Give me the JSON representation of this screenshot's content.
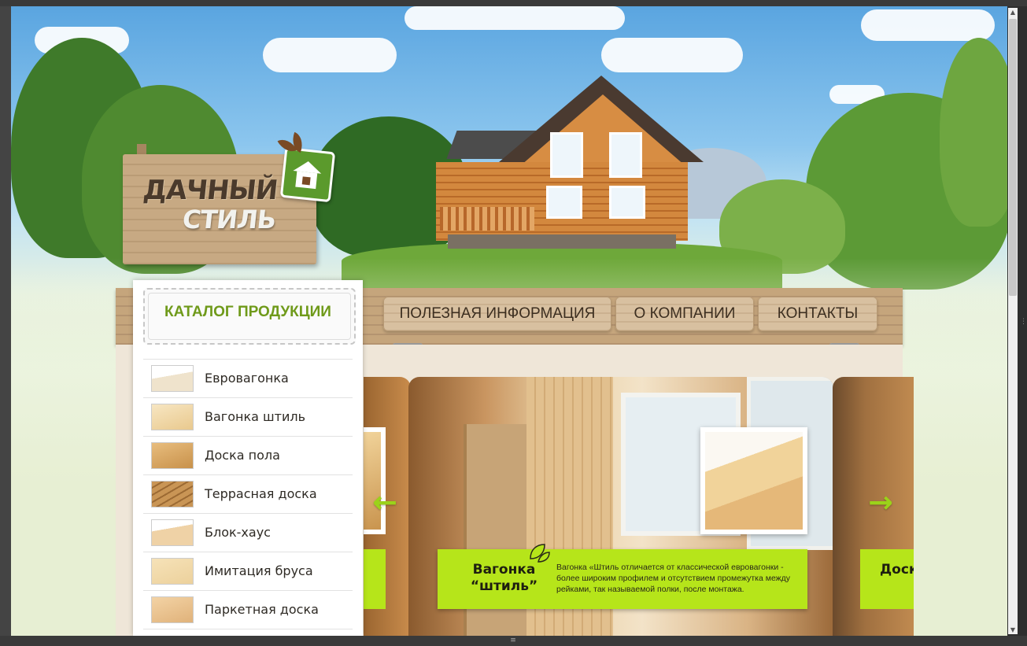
{
  "logo": {
    "line1": "ДАЧНЫЙ",
    "line2": "СТИЛЬ"
  },
  "nav": {
    "catalog_title": "КАТАЛОГ ПРОДУКЦИИ",
    "items": [
      {
        "label": "ПОЛЕЗНАЯ ИНФОРМАЦИЯ"
      },
      {
        "label": "О КОМПАНИИ"
      },
      {
        "label": "КОНТАКТЫ"
      }
    ]
  },
  "catalog": {
    "items": [
      {
        "label": "Евровагонка",
        "thumb": "#efe3cc"
      },
      {
        "label": "Вагонка штиль",
        "thumb": "#e9c98e"
      },
      {
        "label": "Доска пола",
        "thumb": "#d7a760"
      },
      {
        "label": "Террасная доска",
        "thumb": "#b88444"
      },
      {
        "label": "Блок-хаус",
        "thumb": "#efd2a6"
      },
      {
        "label": "Имитация бруса",
        "thumb": "#ecd19c"
      },
      {
        "label": "Паркетная доска",
        "thumb": "#e0b27a"
      }
    ]
  },
  "slider": {
    "caption_title": "Вагонка “штиль”",
    "caption_desc": "Вагонка «Штиль отличается от классической евровагонки - более широким профилем и отсутствием промежутка между рейками, так называемой полки, после монтажа.",
    "next_caption": "Доска пола",
    "prev_icon": "arrow-left-icon",
    "next_icon": "arrow-right-icon"
  },
  "colors": {
    "accent_green": "#b6e51a",
    "catalog_green": "#6f9a1a",
    "wood": "#c5a57c"
  }
}
